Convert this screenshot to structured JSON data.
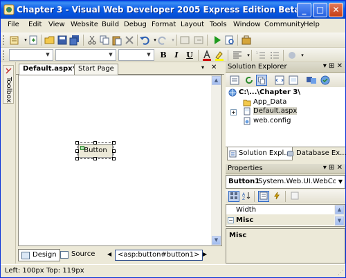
{
  "window": {
    "title": "Chapter 3 - Visual Web Developer 2005 Express Edition Beta",
    "controls": {
      "minimize": "_",
      "maximize": "□",
      "close": "✕"
    }
  },
  "menu": {
    "items": [
      "File",
      "Edit",
      "View",
      "Website",
      "Build",
      "Debug",
      "Format",
      "Layout",
      "Tools",
      "Window",
      "Community",
      "Help"
    ]
  },
  "format_toolbar": {
    "bold": "B",
    "italic": "I",
    "underline": "U"
  },
  "toolbox": {
    "label": "Toolbox"
  },
  "document": {
    "tabs": [
      "Default.aspx*",
      "Start Page"
    ],
    "close_glyph": "✕",
    "pin_glyph": "▾",
    "button_text": "Button",
    "view_design": "Design",
    "view_source": "Source",
    "tag_navigator": "<asp:button#button1>"
  },
  "solution_explorer": {
    "title": "Solution Explorer",
    "pane_buttons": "▾ ⊞ ✕",
    "tree": {
      "root": "C:\\...\\Chapter 3\\",
      "children": [
        "App_Data",
        "Default.aspx",
        "web.config"
      ]
    },
    "tabs": [
      "Solution Expl...",
      "Database Ex..."
    ]
  },
  "properties": {
    "title": "Properties",
    "pane_buttons": "▾ ⊞ ✕",
    "object": {
      "name": "Button1",
      "type": "System.Web.UI.WebContro"
    },
    "rows": [
      {
        "label": "Width",
        "type": "property"
      },
      {
        "label": "Misc",
        "type": "category"
      }
    ],
    "description_title": "Misc"
  },
  "status": {
    "text": "Left: 100px  Top: 119px"
  },
  "colors": {
    "title_bar": "#0a5fe8",
    "chrome": "#ece9d8",
    "selection": "#316ac5"
  }
}
